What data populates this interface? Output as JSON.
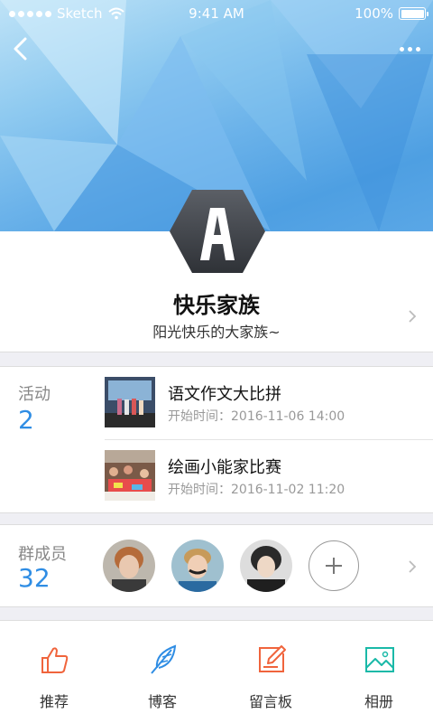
{
  "status_bar": {
    "carrier": "Sketch",
    "time": "9:41 AM",
    "battery": "100%"
  },
  "header": {
    "back_icon": "chevron-left-icon",
    "more_icon": "more-horizontal-icon"
  },
  "group": {
    "name": "快乐家族",
    "description": "阳光快乐的大家族~",
    "logo_letter": "A"
  },
  "activities": {
    "label": "活动",
    "count": "2",
    "items": [
      {
        "title": "语文作文大比拼",
        "time": "开始时间：2016-11-06 14:00"
      },
      {
        "title": "绘画小能家比赛",
        "time": "开始时间：2016-11-02 11:20"
      }
    ]
  },
  "members": {
    "label": "群成员",
    "count": "32"
  },
  "tabs": [
    {
      "label": "推荐",
      "icon": "thumbs-up-icon",
      "color": "#f0643c"
    },
    {
      "label": "博客",
      "icon": "feather-icon",
      "color": "#2f8de4"
    },
    {
      "label": "留言板",
      "icon": "edit-note-icon",
      "color": "#f0643c"
    },
    {
      "label": "相册",
      "icon": "photo-icon",
      "color": "#1ab9a8"
    }
  ],
  "colors": {
    "accent_blue": "#2f8de4",
    "orange": "#f0643c",
    "teal": "#1ab9a8"
  }
}
